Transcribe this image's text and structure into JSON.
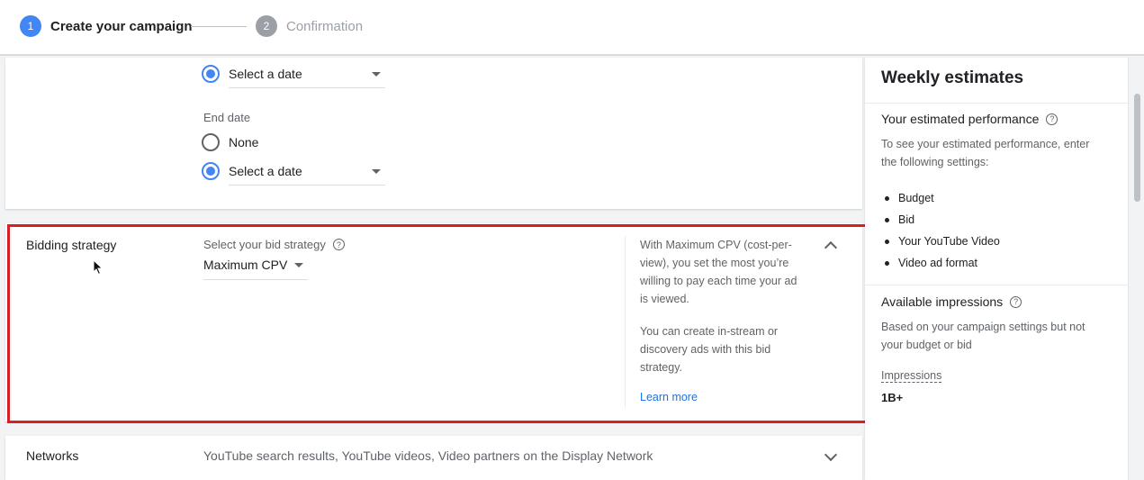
{
  "stepper": {
    "step1_number": "1",
    "step1_label": "Create your campaign",
    "step2_number": "2",
    "step2_label": "Confirmation"
  },
  "dates": {
    "start_selected_option": "Select a date",
    "end_date_title": "End date",
    "end_none_label": "None",
    "end_selected_option": "Select a date"
  },
  "bidding": {
    "title": "Bidding strategy",
    "select_label": "Select your bid strategy",
    "selected_strategy": "Maximum CPV",
    "info_paragraph1": "With Maximum CPV (cost-per-view), you set the most you’re willing to pay each time your ad is viewed.",
    "info_paragraph2": "You can create in-stream or discovery ads with this bid strategy.",
    "learn_more": "Learn more"
  },
  "networks": {
    "title": "Networks",
    "summary": "YouTube search results, YouTube videos, Video partners on the Display Network"
  },
  "sidebar": {
    "title": "Weekly estimates",
    "performance_title": "Your estimated performance",
    "performance_desc": "To see your estimated performance, enter the following settings:",
    "settings": [
      "Budget",
      "Bid",
      "Your YouTube Video",
      "Video ad format"
    ],
    "impressions_title": "Available impressions",
    "impressions_desc": "Based on your campaign settings but not your budget or bid",
    "impressions_label": "Impressions",
    "impressions_value": "1B+"
  },
  "icons": {
    "help": "help-circle-icon",
    "expand": "chevron-down-icon",
    "collapse": "chevron-up-icon",
    "dropdown": "caret-down-icon"
  },
  "colors": {
    "accent": "#4285f4",
    "highlight_border": "#d81f26",
    "link": "#1a73e8"
  }
}
